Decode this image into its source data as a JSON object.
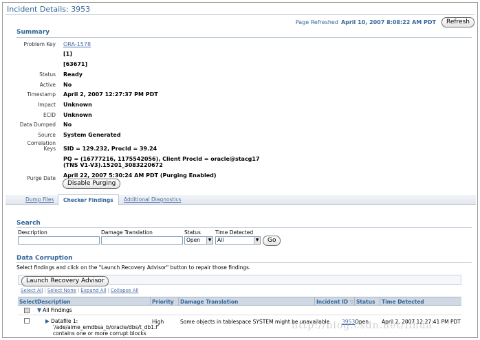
{
  "page": {
    "title": "Incident Details: 3953",
    "refreshed_label": "Page Refreshed",
    "refreshed_date": "April 10, 2007 8:08:22 AM PDT",
    "refresh_button": "Refresh"
  },
  "summary": {
    "heading": "Summary",
    "problem_key_label": "Problem Key",
    "problem_key_link": "ORA-1578",
    "problem_key_line2": "[1]",
    "problem_key_line3": "[63671]",
    "status_label": "Status",
    "status_value": "Ready",
    "active_label": "Active",
    "active_value": "No",
    "timestamp_label": "Timestamp",
    "timestamp_value": "April 2, 2007 12:27:37 PM PDT",
    "impact_label": "Impact",
    "impact_value": "Unknown",
    "ecid_label": "ECID",
    "ecid_value": "Unknown",
    "data_dumped_label": "Data Dumped",
    "data_dumped_value": "No",
    "source_label": "Source",
    "source_value": "System Generated",
    "correlation_label_1": "Correlation",
    "correlation_label_2": "Keys",
    "correlation_line1": "SID = 129.232, ProcId = 39.24",
    "correlation_line2": "PQ = (16777216, 1175542056), Client ProcId = oracle@stacg17",
    "correlation_line3": "(TNS V1-V3).15201_3083220672",
    "purge_label": "Purge Date",
    "purge_value": "April 22, 2007 5:30:24 AM PDT (Purging Enabled)",
    "disable_purging_button": "Disable Purging"
  },
  "tabs": {
    "dump_files": "Dump Files",
    "checker_findings": "Checker Findings",
    "additional_diagnostics": "Additional Diagnostics"
  },
  "search": {
    "heading": "Search",
    "description_label": "Description",
    "damage_label": "Damage Translation",
    "status_label": "Status",
    "status_value": "Open",
    "time_label": "Time Detected",
    "time_value": "All",
    "go_button": "Go"
  },
  "data_corruption": {
    "heading": "Data Corruption",
    "instructions": "Select findings and click on the \"Launch Recovery Advisor\" button to repair those findings.",
    "launch_button": "Launch Recovery Advisor",
    "select_all": "Select All",
    "select_none": "Select None",
    "expand_all": "Expand All",
    "collapse_all": "Collapse All",
    "columns": {
      "select": "Select",
      "description": "Description",
      "priority": "Priority",
      "damage": "Damage Translation",
      "incident_id": "Incident ID",
      "status": "Status",
      "time_detected": "Time Detected"
    },
    "all_findings": "All Findings",
    "row": {
      "desc_line1": "Datafile 1:",
      "desc_line2": "'/ade/aime_emdbsa_b/oracle/dbs/t_db1.f'",
      "desc_line3": "contains one or more corrupt blocks",
      "priority": "High",
      "damage": "Some objects in tablespace SYSTEM might be unavailable",
      "incident_id": "3953",
      "status": "Open",
      "time_detected": "April 2, 2007 12:27:41 PM PDT"
    }
  },
  "watermark": "http://blog.csdn.net/lihua"
}
